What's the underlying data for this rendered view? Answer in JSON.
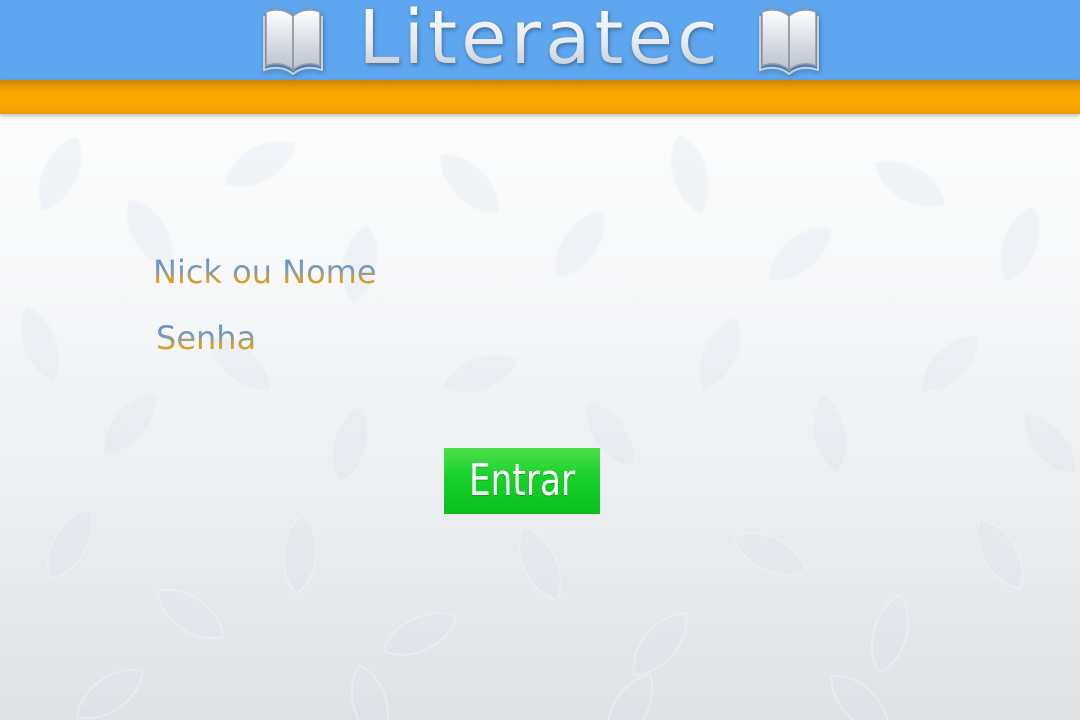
{
  "app": {
    "title": "Literatec",
    "icons": [
      "open-book-icon",
      "open-book-icon"
    ]
  },
  "login": {
    "nick_label": "Nick ou Nome",
    "password_label": "Senha",
    "nick_value": "",
    "password_value": "",
    "submit_label": "Entrar"
  },
  "colors": {
    "header_blue": "#5ea7f0",
    "header_orange": "#ffa800",
    "button_green": "#17d12a",
    "label_blue": "#5a8fd0",
    "label_gold": "#e2a21a"
  }
}
